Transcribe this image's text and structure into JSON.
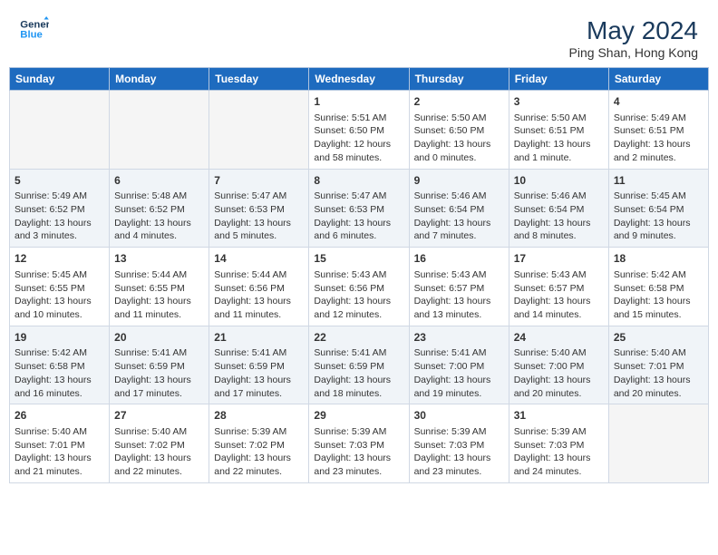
{
  "header": {
    "logo_line1": "General",
    "logo_line2": "Blue",
    "month_year": "May 2024",
    "location": "Ping Shan, Hong Kong"
  },
  "days_of_week": [
    "Sunday",
    "Monday",
    "Tuesday",
    "Wednesday",
    "Thursday",
    "Friday",
    "Saturday"
  ],
  "weeks": [
    [
      {
        "day": "",
        "info": ""
      },
      {
        "day": "",
        "info": ""
      },
      {
        "day": "",
        "info": ""
      },
      {
        "day": "1",
        "sunrise": "5:51 AM",
        "sunset": "6:50 PM",
        "daylight": "12 hours and 58 minutes."
      },
      {
        "day": "2",
        "sunrise": "5:50 AM",
        "sunset": "6:50 PM",
        "daylight": "13 hours and 0 minutes."
      },
      {
        "day": "3",
        "sunrise": "5:50 AM",
        "sunset": "6:51 PM",
        "daylight": "13 hours and 1 minute."
      },
      {
        "day": "4",
        "sunrise": "5:49 AM",
        "sunset": "6:51 PM",
        "daylight": "13 hours and 2 minutes."
      }
    ],
    [
      {
        "day": "5",
        "sunrise": "5:49 AM",
        "sunset": "6:52 PM",
        "daylight": "13 hours and 3 minutes."
      },
      {
        "day": "6",
        "sunrise": "5:48 AM",
        "sunset": "6:52 PM",
        "daylight": "13 hours and 4 minutes."
      },
      {
        "day": "7",
        "sunrise": "5:47 AM",
        "sunset": "6:53 PM",
        "daylight": "13 hours and 5 minutes."
      },
      {
        "day": "8",
        "sunrise": "5:47 AM",
        "sunset": "6:53 PM",
        "daylight": "13 hours and 6 minutes."
      },
      {
        "day": "9",
        "sunrise": "5:46 AM",
        "sunset": "6:54 PM",
        "daylight": "13 hours and 7 minutes."
      },
      {
        "day": "10",
        "sunrise": "5:46 AM",
        "sunset": "6:54 PM",
        "daylight": "13 hours and 8 minutes."
      },
      {
        "day": "11",
        "sunrise": "5:45 AM",
        "sunset": "6:54 PM",
        "daylight": "13 hours and 9 minutes."
      }
    ],
    [
      {
        "day": "12",
        "sunrise": "5:45 AM",
        "sunset": "6:55 PM",
        "daylight": "13 hours and 10 minutes."
      },
      {
        "day": "13",
        "sunrise": "5:44 AM",
        "sunset": "6:55 PM",
        "daylight": "13 hours and 11 minutes."
      },
      {
        "day": "14",
        "sunrise": "5:44 AM",
        "sunset": "6:56 PM",
        "daylight": "13 hours and 11 minutes."
      },
      {
        "day": "15",
        "sunrise": "5:43 AM",
        "sunset": "6:56 PM",
        "daylight": "13 hours and 12 minutes."
      },
      {
        "day": "16",
        "sunrise": "5:43 AM",
        "sunset": "6:57 PM",
        "daylight": "13 hours and 13 minutes."
      },
      {
        "day": "17",
        "sunrise": "5:43 AM",
        "sunset": "6:57 PM",
        "daylight": "13 hours and 14 minutes."
      },
      {
        "day": "18",
        "sunrise": "5:42 AM",
        "sunset": "6:58 PM",
        "daylight": "13 hours and 15 minutes."
      }
    ],
    [
      {
        "day": "19",
        "sunrise": "5:42 AM",
        "sunset": "6:58 PM",
        "daylight": "13 hours and 16 minutes."
      },
      {
        "day": "20",
        "sunrise": "5:41 AM",
        "sunset": "6:59 PM",
        "daylight": "13 hours and 17 minutes."
      },
      {
        "day": "21",
        "sunrise": "5:41 AM",
        "sunset": "6:59 PM",
        "daylight": "13 hours and 17 minutes."
      },
      {
        "day": "22",
        "sunrise": "5:41 AM",
        "sunset": "6:59 PM",
        "daylight": "13 hours and 18 minutes."
      },
      {
        "day": "23",
        "sunrise": "5:41 AM",
        "sunset": "7:00 PM",
        "daylight": "13 hours and 19 minutes."
      },
      {
        "day": "24",
        "sunrise": "5:40 AM",
        "sunset": "7:00 PM",
        "daylight": "13 hours and 20 minutes."
      },
      {
        "day": "25",
        "sunrise": "5:40 AM",
        "sunset": "7:01 PM",
        "daylight": "13 hours and 20 minutes."
      }
    ],
    [
      {
        "day": "26",
        "sunrise": "5:40 AM",
        "sunset": "7:01 PM",
        "daylight": "13 hours and 21 minutes."
      },
      {
        "day": "27",
        "sunrise": "5:40 AM",
        "sunset": "7:02 PM",
        "daylight": "13 hours and 22 minutes."
      },
      {
        "day": "28",
        "sunrise": "5:39 AM",
        "sunset": "7:02 PM",
        "daylight": "13 hours and 22 minutes."
      },
      {
        "day": "29",
        "sunrise": "5:39 AM",
        "sunset": "7:03 PM",
        "daylight": "13 hours and 23 minutes."
      },
      {
        "day": "30",
        "sunrise": "5:39 AM",
        "sunset": "7:03 PM",
        "daylight": "13 hours and 23 minutes."
      },
      {
        "day": "31",
        "sunrise": "5:39 AM",
        "sunset": "7:03 PM",
        "daylight": "13 hours and 24 minutes."
      },
      {
        "day": "",
        "info": ""
      }
    ]
  ],
  "labels": {
    "sunrise": "Sunrise:",
    "sunset": "Sunset:",
    "daylight": "Daylight:"
  }
}
